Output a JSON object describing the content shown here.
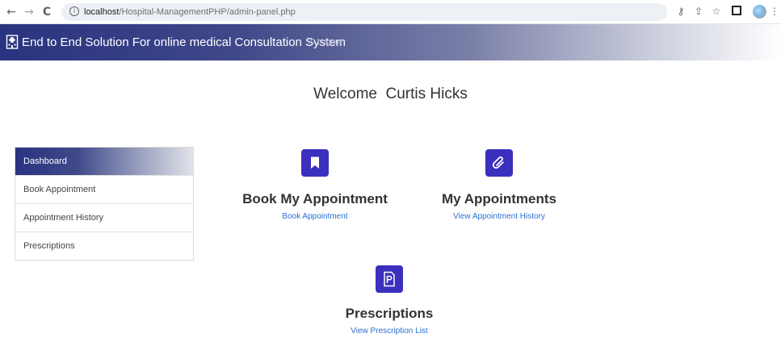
{
  "browser": {
    "back_label": "←",
    "forward_label": "→",
    "reload_label": "C",
    "url_host": "localhost",
    "url_path": "/Hospital-ManagementPHP/admin-panel.php"
  },
  "header": {
    "brand_title": "End to End Solution For online medical Consultation System",
    "logout_label": "Logout"
  },
  "welcome": {
    "text": "Welcome  Curtis Hicks"
  },
  "sidebar": {
    "items": [
      {
        "label": "Dashboard",
        "active": true
      },
      {
        "label": "Book Appointment",
        "active": false
      },
      {
        "label": "Appointment History",
        "active": false
      },
      {
        "label": "Prescriptions",
        "active": false
      }
    ]
  },
  "cards": {
    "book": {
      "title": "Book My Appointment",
      "link": "Book Appointment",
      "icon": "bookmark-icon"
    },
    "appointments": {
      "title": "My Appointments",
      "link": "View Appointment History",
      "icon": "paperclip-icon"
    },
    "prescriptions": {
      "title": "Prescriptions",
      "link": "View Prescription List",
      "icon": "prescription-icon"
    }
  },
  "colors": {
    "header_start": "#2a3380",
    "icon_bg": "#3b2fbd",
    "link": "#2c6fd1"
  }
}
